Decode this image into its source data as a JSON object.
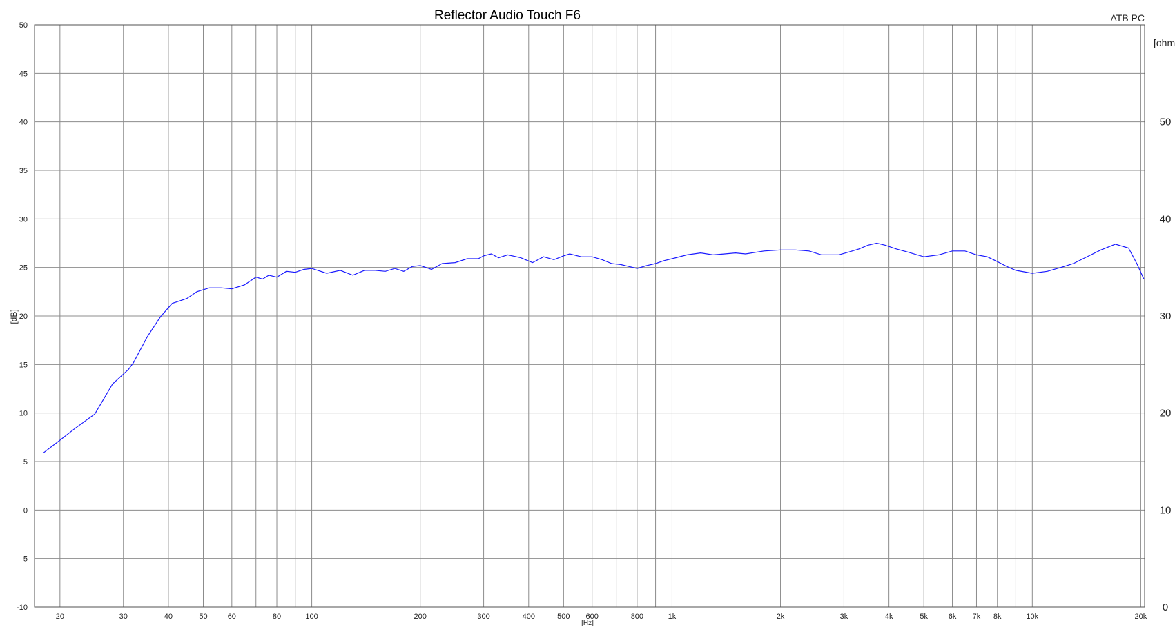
{
  "chart_data": {
    "type": "line",
    "title": "Reflector Audio Touch F6",
    "corner_label": "ATB PC",
    "xlabel": "[Hz]",
    "ylabel": "[dB]",
    "y2label": "[ohm]",
    "xscale": "log",
    "xlim": [
      17,
      20500
    ],
    "ylim": [
      -10,
      50
    ],
    "y2lim": [
      0,
      60
    ],
    "grid": true,
    "colors": {
      "line": "#1a1aff",
      "grid": "#8c8c8c",
      "frame": "#505050"
    },
    "x_ticks": [
      {
        "v": 20,
        "label": "20"
      },
      {
        "v": 30,
        "label": "30"
      },
      {
        "v": 40,
        "label": "40"
      },
      {
        "v": 50,
        "label": "50"
      },
      {
        "v": 60,
        "label": "60"
      },
      {
        "v": 80,
        "label": "80"
      },
      {
        "v": 100,
        "label": "100"
      },
      {
        "v": 200,
        "label": "200"
      },
      {
        "v": 300,
        "label": "300"
      },
      {
        "v": 400,
        "label": "400"
      },
      {
        "v": 500,
        "label": "500"
      },
      {
        "v": 600,
        "label": "600"
      },
      {
        "v": 800,
        "label": "800"
      },
      {
        "v": 1000,
        "label": "1k"
      },
      {
        "v": 2000,
        "label": "2k"
      },
      {
        "v": 3000,
        "label": "3k"
      },
      {
        "v": 4000,
        "label": "4k"
      },
      {
        "v": 5000,
        "label": "5k"
      },
      {
        "v": 6000,
        "label": "6k"
      },
      {
        "v": 7000,
        "label": "7k"
      },
      {
        "v": 8000,
        "label": "8k"
      },
      {
        "v": 10000,
        "label": "10k"
      },
      {
        "v": 20000,
        "label": "20k"
      }
    ],
    "x_gridlines": [
      20,
      30,
      40,
      50,
      60,
      70,
      80,
      90,
      100,
      200,
      300,
      400,
      500,
      600,
      700,
      800,
      900,
      1000,
      2000,
      3000,
      4000,
      5000,
      6000,
      7000,
      8000,
      9000,
      10000,
      20000
    ],
    "y_ticks": [
      {
        "v": 50,
        "label": "50"
      },
      {
        "v": 45,
        "label": "45"
      },
      {
        "v": 40,
        "label": "40"
      },
      {
        "v": 35,
        "label": "35"
      },
      {
        "v": 30,
        "label": "30"
      },
      {
        "v": 25,
        "label": "25"
      },
      {
        "v": 20,
        "label": "20"
      },
      {
        "v": 15,
        "label": "15"
      },
      {
        "v": 10,
        "label": "10"
      },
      {
        "v": 5,
        "label": "5"
      },
      {
        "v": 0,
        "label": "0"
      },
      {
        "v": -5,
        "label": "-5"
      },
      {
        "v": -10,
        "label": "-10"
      }
    ],
    "y2_ticks": [
      {
        "v": 50,
        "label": "50"
      },
      {
        "v": 40,
        "label": "40"
      },
      {
        "v": 30,
        "label": "30"
      },
      {
        "v": 20,
        "label": "20"
      },
      {
        "v": 10,
        "label": "10"
      },
      {
        "v": 0,
        "label": "0"
      }
    ],
    "series": [
      {
        "points": [
          [
            18,
            5.9
          ],
          [
            20,
            7.2
          ],
          [
            22,
            8.4
          ],
          [
            25,
            9.9
          ],
          [
            28,
            13.0
          ],
          [
            31,
            14.5
          ],
          [
            32,
            15.2
          ],
          [
            35,
            17.9
          ],
          [
            38,
            19.9
          ],
          [
            41,
            21.3
          ],
          [
            45,
            21.8
          ],
          [
            48,
            22.5
          ],
          [
            52,
            22.9
          ],
          [
            56,
            22.9
          ],
          [
            60,
            22.8
          ],
          [
            65,
            23.2
          ],
          [
            70,
            24.0
          ],
          [
            73,
            23.8
          ],
          [
            76,
            24.2
          ],
          [
            80,
            24.0
          ],
          [
            85,
            24.6
          ],
          [
            90,
            24.5
          ],
          [
            95,
            24.8
          ],
          [
            100,
            24.9
          ],
          [
            110,
            24.4
          ],
          [
            120,
            24.7
          ],
          [
            130,
            24.2
          ],
          [
            140,
            24.7
          ],
          [
            150,
            24.7
          ],
          [
            160,
            24.6
          ],
          [
            170,
            24.9
          ],
          [
            180,
            24.6
          ],
          [
            190,
            25.1
          ],
          [
            200,
            25.2
          ],
          [
            215,
            24.8
          ],
          [
            230,
            25.4
          ],
          [
            250,
            25.5
          ],
          [
            270,
            25.9
          ],
          [
            290,
            25.9
          ],
          [
            300,
            26.2
          ],
          [
            315,
            26.4
          ],
          [
            330,
            26.0
          ],
          [
            350,
            26.3
          ],
          [
            380,
            26.0
          ],
          [
            410,
            25.5
          ],
          [
            440,
            26.1
          ],
          [
            470,
            25.8
          ],
          [
            500,
            26.2
          ],
          [
            520,
            26.4
          ],
          [
            560,
            26.1
          ],
          [
            600,
            26.1
          ],
          [
            640,
            25.8
          ],
          [
            680,
            25.4
          ],
          [
            720,
            25.3
          ],
          [
            760,
            25.1
          ],
          [
            800,
            24.9
          ],
          [
            850,
            25.2
          ],
          [
            900,
            25.4
          ],
          [
            950,
            25.7
          ],
          [
            1000,
            25.9
          ],
          [
            1100,
            26.3
          ],
          [
            1200,
            26.5
          ],
          [
            1300,
            26.3
          ],
          [
            1400,
            26.4
          ],
          [
            1500,
            26.5
          ],
          [
            1600,
            26.4
          ],
          [
            1800,
            26.7
          ],
          [
            2000,
            26.8
          ],
          [
            2200,
            26.8
          ],
          [
            2400,
            26.7
          ],
          [
            2600,
            26.3
          ],
          [
            2900,
            26.3
          ],
          [
            3100,
            26.6
          ],
          [
            3300,
            26.9
          ],
          [
            3500,
            27.3
          ],
          [
            3700,
            27.5
          ],
          [
            3900,
            27.3
          ],
          [
            4200,
            26.9
          ],
          [
            4500,
            26.6
          ],
          [
            5000,
            26.1
          ],
          [
            5500,
            26.3
          ],
          [
            6000,
            26.7
          ],
          [
            6500,
            26.7
          ],
          [
            7000,
            26.3
          ],
          [
            7500,
            26.1
          ],
          [
            8000,
            25.6
          ],
          [
            8500,
            25.1
          ],
          [
            9000,
            24.7
          ],
          [
            10000,
            24.4
          ],
          [
            11000,
            24.6
          ],
          [
            12000,
            25.0
          ],
          [
            13000,
            25.4
          ],
          [
            14000,
            26.0
          ],
          [
            15500,
            26.8
          ],
          [
            17000,
            27.4
          ],
          [
            18500,
            27.0
          ],
          [
            19500,
            25.4
          ],
          [
            20400,
            23.8
          ]
        ]
      }
    ]
  }
}
